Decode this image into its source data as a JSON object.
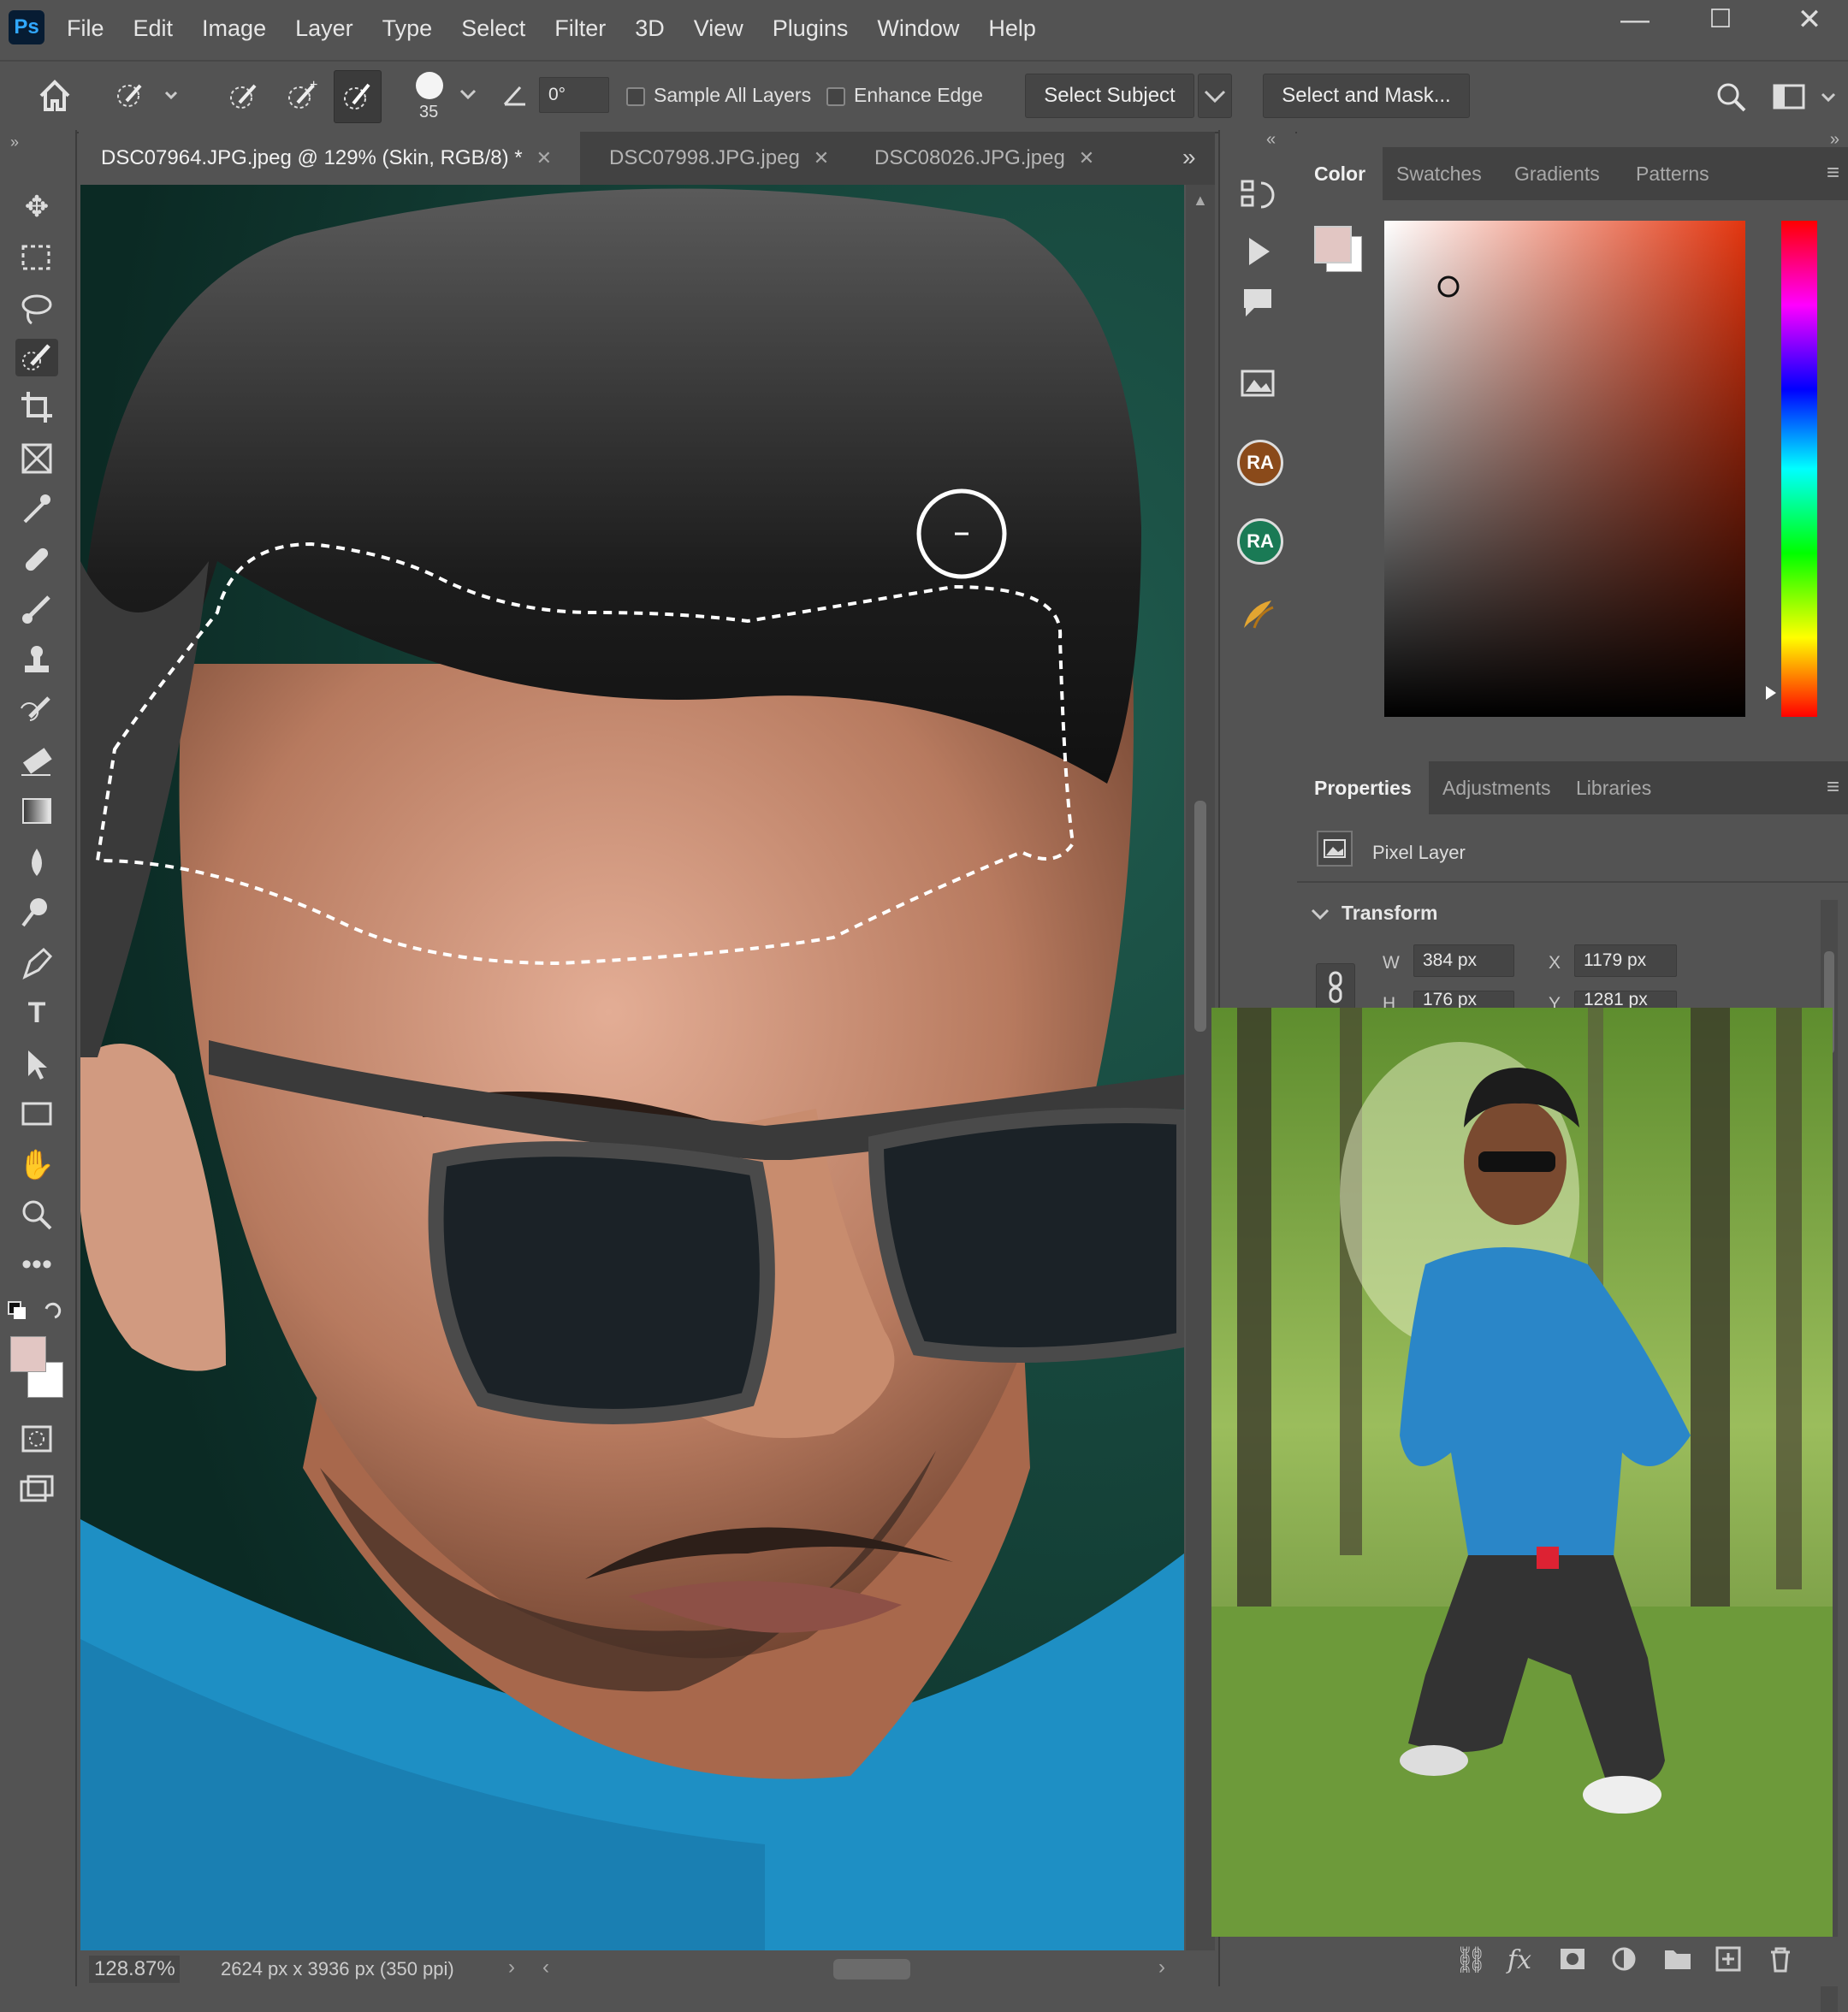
{
  "app": {
    "logo": "Ps"
  },
  "menu": [
    "File",
    "Edit",
    "Image",
    "Layer",
    "Type",
    "Select",
    "Filter",
    "3D",
    "View",
    "Plugins",
    "Window",
    "Help"
  ],
  "window_controls": {
    "minimize": "—",
    "maximize": "☐",
    "close": "✕"
  },
  "options_bar": {
    "brush_size": "35",
    "angle": "0°",
    "sample_all_layers": "Sample All Layers",
    "enhance_edge": "Enhance Edge",
    "select_subject": "Select Subject",
    "select_and_mask": "Select and Mask..."
  },
  "tabs": [
    {
      "label": "DSC07964.JPG.jpeg @ 129% (Skin, RGB/8) *",
      "active": true
    },
    {
      "label": "DSC07998.JPG.jpeg",
      "active": false
    },
    {
      "label": "DSC08026.JPG.jpeg",
      "active": false
    }
  ],
  "tools": [
    "move-icon",
    "marquee-icon",
    "lasso-icon",
    "quick-selection-icon",
    "crop-icon",
    "frame-icon",
    "eyedropper-icon",
    "healing-brush-icon",
    "brush-icon",
    "clone-stamp-icon",
    "history-brush-icon",
    "eraser-icon",
    "gradient-icon",
    "blur-icon",
    "dodge-icon",
    "pen-icon",
    "type-icon",
    "path-selection-icon",
    "rectangle-icon",
    "hand-icon",
    "zoom-icon",
    "more-tools-icon"
  ],
  "colors": {
    "foreground": "#e2c6c3",
    "background": "#ffffff",
    "panel_bg": "#535353",
    "panel_dark": "#424242",
    "ra_brown": "#8a4a1a",
    "ra_green": "#1a7a55"
  },
  "side_icons": {
    "ra_label_1": "RA",
    "ra_label_2": "RA"
  },
  "color_panel": {
    "tabs": [
      "Color",
      "Swatches",
      "Gradients",
      "Patterns"
    ],
    "active_tab": "Color"
  },
  "properties_panel": {
    "tabs": [
      "Properties",
      "Adjustments",
      "Libraries"
    ],
    "active_tab": "Properties",
    "layer_type": "Pixel Layer",
    "section": "Transform",
    "w_label": "W",
    "w_value": "384 px",
    "x_label": "X",
    "x_value": "1179 px",
    "h_label": "H",
    "h_value": "176 px",
    "y_label": "Y",
    "y_value": "1281 px"
  },
  "status": {
    "zoom": "128.87%",
    "doc_info": "2624 px x 3936 px (350 ppi)"
  }
}
